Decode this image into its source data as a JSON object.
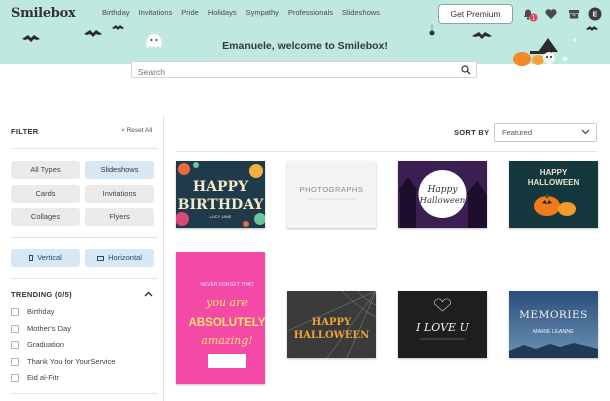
{
  "header": {
    "logo": "Smilebox",
    "nav": [
      "Birthday",
      "Invitations",
      "Pride",
      "Holidays",
      "Sympathy",
      "Professionals",
      "Slideshows"
    ],
    "premium_label": "Get Premium",
    "notification_count": "1",
    "avatar_initial": "E",
    "icons": [
      "bell-icon",
      "heart-icon",
      "box-icon",
      "avatar"
    ]
  },
  "banner": {
    "welcome": "Emanuele, welcome to Smilebox!"
  },
  "search": {
    "placeholder": "Search"
  },
  "filter": {
    "title": "FILTER",
    "reset_label": "Reset All",
    "types": [
      {
        "label": "All Types",
        "active": false
      },
      {
        "label": "Slideshows",
        "active": true
      },
      {
        "label": "Cards",
        "active": false
      },
      {
        "label": "Invitations",
        "active": false
      },
      {
        "label": "Collages",
        "active": false
      },
      {
        "label": "Flyers",
        "active": false
      }
    ],
    "orientation": [
      {
        "label": "Vertical",
        "icon": "portrait-icon"
      },
      {
        "label": "Horizontal",
        "icon": "landscape-icon"
      }
    ]
  },
  "trending": {
    "title": "TRENDING (0/5)",
    "items": [
      "Birthday",
      "Mother's Day",
      "Graduation",
      "Thank You for YourService",
      "Eid al-Fitr"
    ]
  },
  "sort": {
    "label": "SORT BY",
    "selected": "Featured"
  },
  "cards": [
    {
      "name": "happy-birthday-card",
      "line1": "HAPPY",
      "line2": "BIRTHDAY",
      "sub": "LUCY JANE"
    },
    {
      "name": "photographs-card",
      "line1": "PHOTOGRAPHS"
    },
    {
      "name": "happy-halloween-purple-card",
      "line1": "Happy",
      "line2": "Halloween"
    },
    {
      "name": "happy-halloween-pumpkin-card",
      "line1": "HAPPY",
      "line2": "HALLOWEEN"
    },
    {
      "name": "absolutely-amazing-card",
      "line1": "NEVER FORGET THAT",
      "line2": "you are",
      "line3": "ABSOLUTELY",
      "line4": "amazing!"
    },
    {
      "name": "happy-halloween-web-card",
      "line1": "HAPPY",
      "line2": "HALLOWEEN"
    },
    {
      "name": "i-love-you-card",
      "line1": "I LOVE U"
    },
    {
      "name": "memories-card",
      "line1": "MEMORIES",
      "line2": "MARIE LEANNE"
    }
  ]
}
